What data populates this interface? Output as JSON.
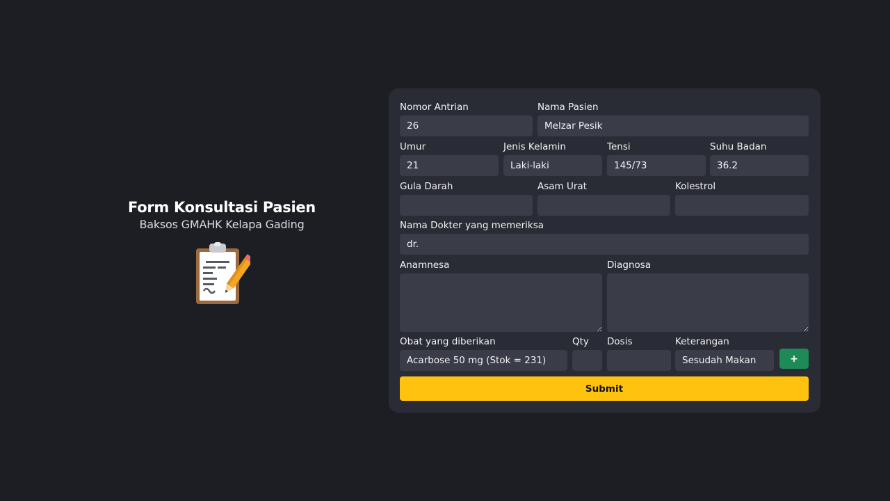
{
  "hero": {
    "title": "Form Konsultasi Pasien",
    "subtitle": "Baksos GMAHK Kelapa Gading",
    "icon": "clipboard-pencil-icon"
  },
  "form": {
    "nomor_antrian": {
      "label": "Nomor Antrian",
      "value": "26"
    },
    "nama_pasien": {
      "label": "Nama Pasien",
      "value": "Melzar Pesik"
    },
    "umur": {
      "label": "Umur",
      "value": "21"
    },
    "jenis_kelamin": {
      "label": "Jenis Kelamin",
      "value": "Laki-laki"
    },
    "tensi": {
      "label": "Tensi",
      "value": "145/73"
    },
    "suhu_badan": {
      "label": "Suhu Badan",
      "value": "36.2"
    },
    "gula_darah": {
      "label": "Gula Darah",
      "value": ""
    },
    "asam_urat": {
      "label": "Asam Urat",
      "value": ""
    },
    "kolestrol": {
      "label": "Kolestrol",
      "value": ""
    },
    "nama_dokter": {
      "label": "Nama Dokter yang memeriksa",
      "value": "dr."
    },
    "anamnesa": {
      "label": "Anamnesa",
      "value": ""
    },
    "diagnosa": {
      "label": "Diagnosa",
      "value": ""
    },
    "obat": {
      "label": "Obat yang diberikan",
      "value": "Acarbose 50 mg (Stok = 231)"
    },
    "qty": {
      "label": "Qty",
      "value": ""
    },
    "dosis": {
      "label": "Dosis",
      "value": ""
    },
    "keterangan": {
      "label": "Keterangan",
      "value": "Sesudah Makan"
    },
    "add_label": "+",
    "submit_label": "Submit"
  },
  "colors": {
    "page_bg": "#1c1e24",
    "card_bg": "#2a2c35",
    "input_bg": "#3a3c47",
    "submit": "#ffc20e",
    "add": "#1e8a57"
  }
}
